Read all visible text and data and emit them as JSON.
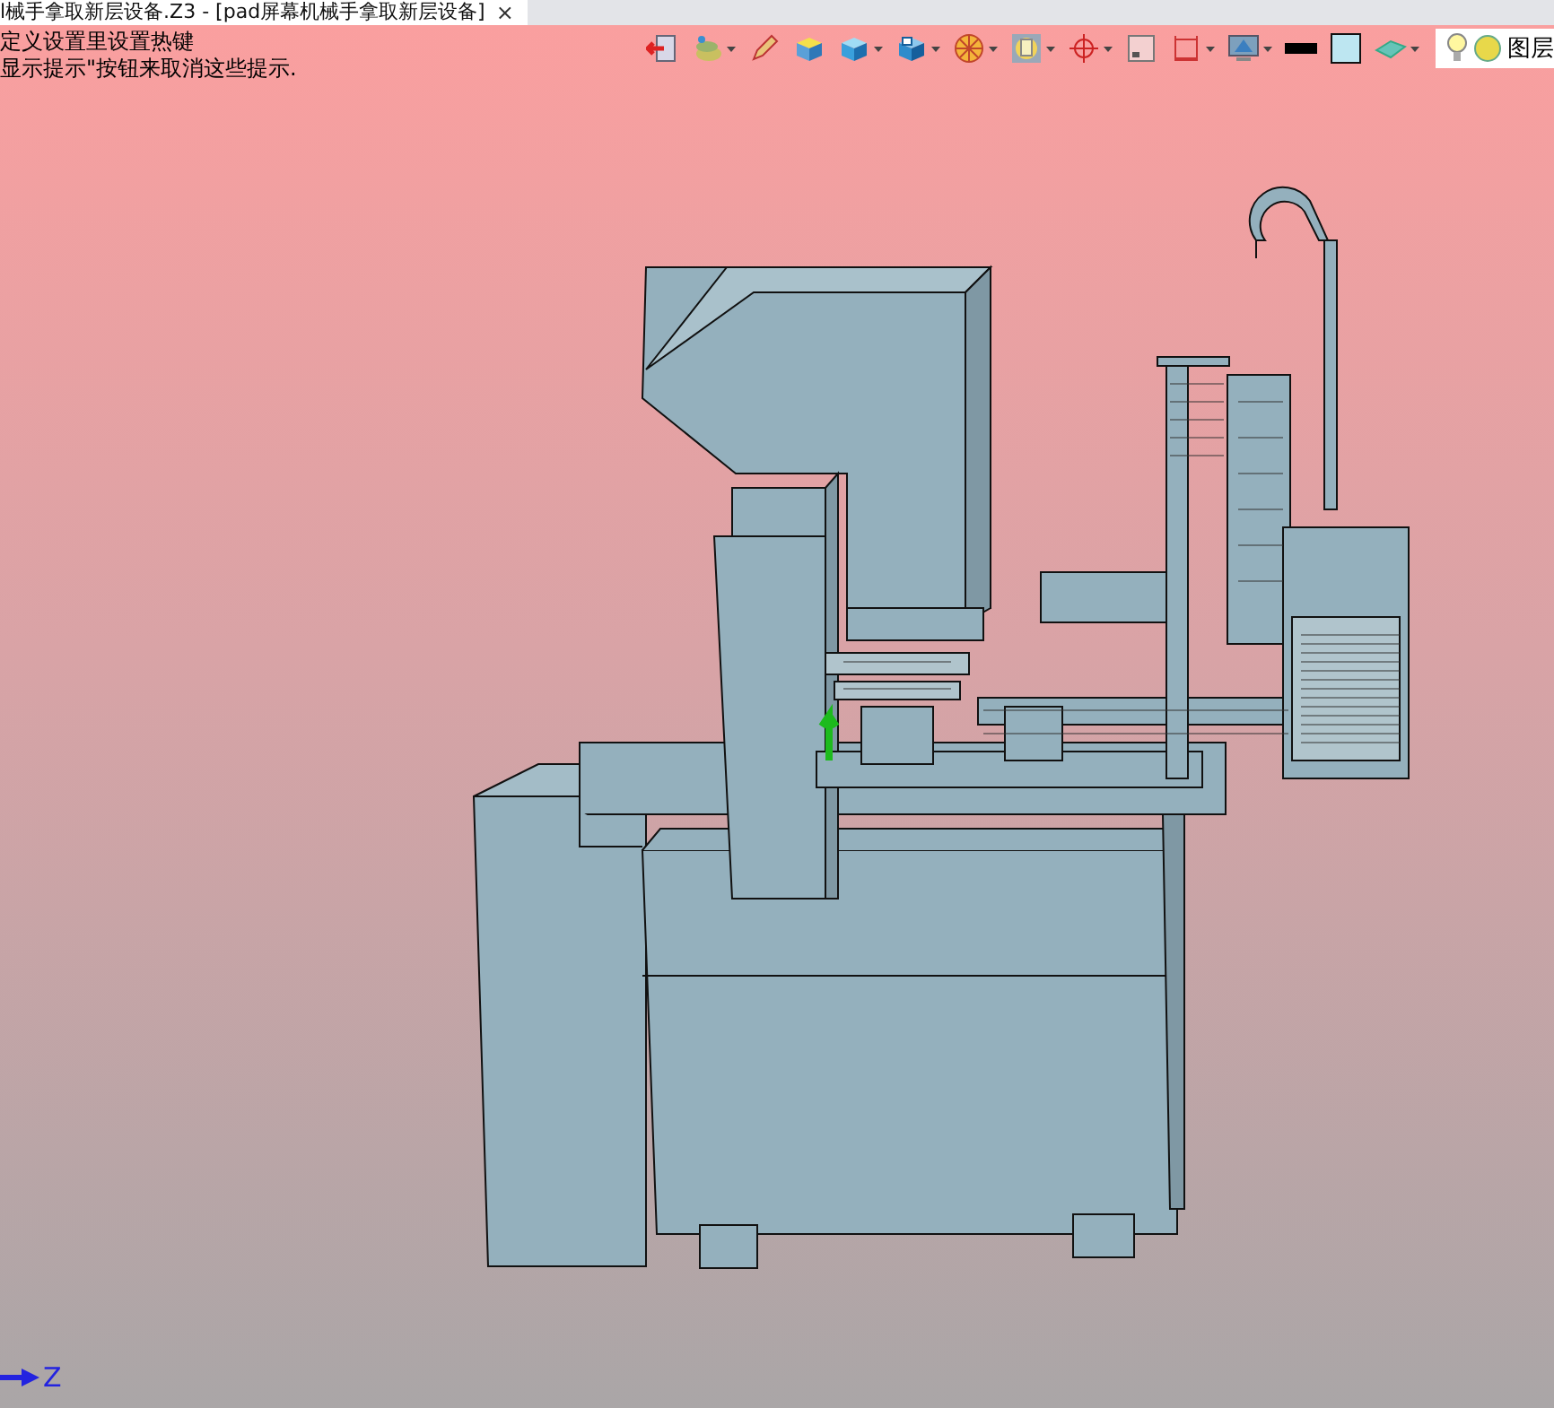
{
  "document_tab": {
    "title": "l械手拿取新层设备.Z3 - [pad屏幕机械手拿取新层设备]",
    "close": "×"
  },
  "hints": [
    "定义设置里设置热键",
    "显示提示\"按钮来取消这些提示."
  ],
  "toolbar": [
    {
      "kind": "exit",
      "dropdown": false
    },
    {
      "kind": "layers",
      "dropdown": true
    },
    {
      "kind": "pencil",
      "dropdown": false
    },
    {
      "kind": "cube-yellow",
      "dropdown": false
    },
    {
      "kind": "cube",
      "dropdown": true
    },
    {
      "kind": "cube-view",
      "dropdown": true
    },
    {
      "kind": "wheel",
      "dropdown": true
    },
    {
      "kind": "frame",
      "dropdown": true
    },
    {
      "kind": "crosshair",
      "dropdown": true
    },
    {
      "kind": "square",
      "dropdown": false
    },
    {
      "kind": "dimension",
      "dropdown": true
    },
    {
      "kind": "monitor",
      "dropdown": true
    },
    {
      "kind": "line",
      "dropdown": false
    },
    {
      "kind": "fill",
      "dropdown": false
    },
    {
      "kind": "plane",
      "dropdown": true
    }
  ],
  "layer_box": {
    "label": "图层"
  },
  "axis": {
    "label": "Z"
  }
}
